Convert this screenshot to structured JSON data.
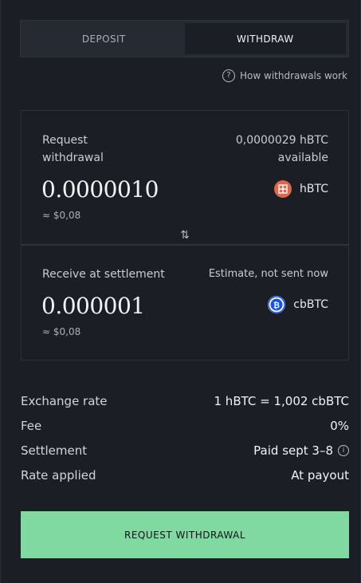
{
  "tabs": {
    "deposit": "DEPOSIT",
    "withdraw": "WITHDRAW"
  },
  "help": {
    "label": "How withdrawals work",
    "icon": "question-circle-icon"
  },
  "request": {
    "label_line1": "Request",
    "label_line2": "withdrawal",
    "available_amount": "0,0000029 hBTC",
    "available_label": "available",
    "amount": "0.0000010",
    "fiat": "≈ $0,08",
    "token": "hBTC",
    "token_icon": "hbtc-coin-icon"
  },
  "swap_icon": "swap-arrows-icon",
  "receive": {
    "label": "Receive at settlement",
    "estimate_note": "Estimate, not sent now",
    "amount": "0.000001",
    "fiat": "≈ $0,08",
    "token": "cbBTC",
    "token_icon": "cbbtc-coin-icon"
  },
  "details": {
    "exchange_rate_label": "Exchange rate",
    "exchange_rate_value": "1 hBTC = 1,002 cbBTC",
    "fee_label": "Fee",
    "fee_value": "0%",
    "settlement_label": "Settlement",
    "settlement_value": "Paid sept 3–8",
    "rate_applied_label": "Rate applied",
    "rate_applied_value": "At payout"
  },
  "cta": {
    "label": "REQUEST WITHDRAWAL"
  },
  "colors": {
    "accent": "#7fd9a0",
    "background": "#1b1e24",
    "hbtc": "#e0664d",
    "cbbtc": "#1652f0"
  }
}
